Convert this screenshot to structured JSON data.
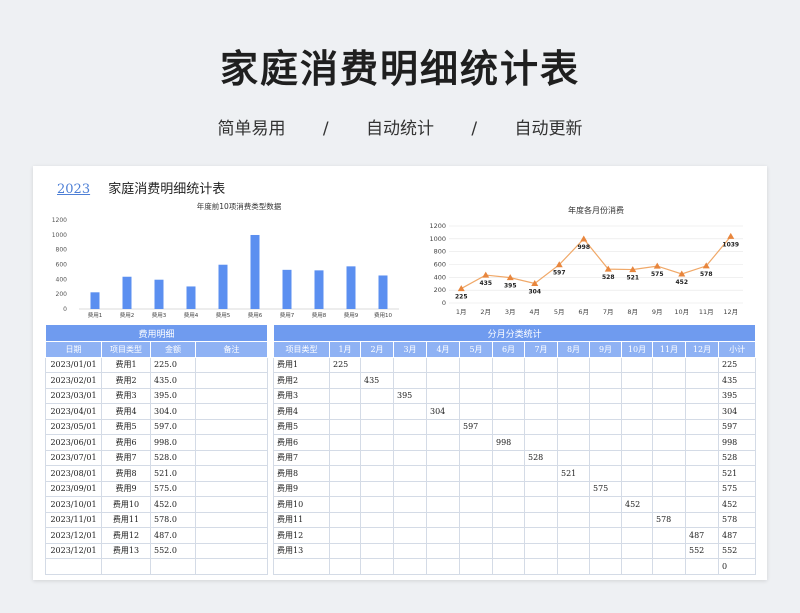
{
  "hero": {
    "title": "家庭消费明细统计表",
    "subtitle": [
      "简单易用",
      "/",
      "自动统计",
      "/",
      "自动更新"
    ]
  },
  "sheet": {
    "year": "2023",
    "title": "家庭消费明细统计表"
  },
  "colors": {
    "bar": "#5b8ff0",
    "line": "#f0a868",
    "marker": "#e8863d",
    "header": "#6f9bef",
    "subheader": "#8fb2f4"
  },
  "chart_data": [
    {
      "type": "bar",
      "title": "年度前10项消费类型数据",
      "categories": [
        "费用1",
        "费用2",
        "费用3",
        "费用4",
        "费用5",
        "费用6",
        "费用7",
        "费用8",
        "费用9",
        "费用10"
      ],
      "values": [
        225,
        435,
        395,
        304,
        597,
        998,
        528,
        521,
        575,
        452
      ],
      "ylim": [
        0,
        1200
      ],
      "yticks": [
        "0",
        "200",
        "400",
        "600",
        "800",
        "1000",
        "1200"
      ],
      "grid": false
    },
    {
      "type": "line",
      "title": "年度各月份消费",
      "categories": [
        "1月",
        "2月",
        "3月",
        "4月",
        "5月",
        "6月",
        "7月",
        "8月",
        "9月",
        "10月",
        "11月",
        "12月"
      ],
      "values": [
        225,
        435,
        395,
        304,
        597,
        998,
        528,
        521,
        575,
        452,
        578,
        1039
      ],
      "ylim": [
        0,
        1200
      ],
      "yticks": [
        "0",
        "200",
        "400",
        "600",
        "800",
        "1000",
        "1200"
      ],
      "grid": true
    }
  ],
  "detail_table": {
    "group_label": "费用明细",
    "headers": [
      "日期",
      "项目类型",
      "金额",
      "备注"
    ],
    "rows": [
      [
        "2023/01/01",
        "费用1",
        "225.0",
        ""
      ],
      [
        "2023/02/01",
        "费用2",
        "435.0",
        ""
      ],
      [
        "2023/03/01",
        "费用3",
        "395.0",
        ""
      ],
      [
        "2023/04/01",
        "费用4",
        "304.0",
        ""
      ],
      [
        "2023/05/01",
        "费用5",
        "597.0",
        ""
      ],
      [
        "2023/06/01",
        "费用6",
        "998.0",
        ""
      ],
      [
        "2023/07/01",
        "费用7",
        "528.0",
        ""
      ],
      [
        "2023/08/01",
        "费用8",
        "521.0",
        ""
      ],
      [
        "2023/09/01",
        "费用9",
        "575.0",
        ""
      ],
      [
        "2023/10/01",
        "费用10",
        "452.0",
        ""
      ],
      [
        "2023/11/01",
        "费用11",
        "578.0",
        ""
      ],
      [
        "2023/12/01",
        "费用12",
        "487.0",
        ""
      ],
      [
        "2023/12/01",
        "费用13",
        "552.0",
        ""
      ],
      [
        "",
        "",
        "",
        ""
      ]
    ]
  },
  "summary_table": {
    "group_label": "分月分类统计",
    "headers": [
      "项目类型",
      "1月",
      "2月",
      "3月",
      "4月",
      "5月",
      "6月",
      "7月",
      "8月",
      "9月",
      "10月",
      "11月",
      "12月",
      "小计"
    ],
    "rows": [
      [
        "费用1",
        "225",
        "",
        "",
        "",
        "",
        "",
        "",
        "",
        "",
        "",
        "",
        "",
        "225"
      ],
      [
        "费用2",
        "",
        "435",
        "",
        "",
        "",
        "",
        "",
        "",
        "",
        "",
        "",
        "",
        "435"
      ],
      [
        "费用3",
        "",
        "",
        "395",
        "",
        "",
        "",
        "",
        "",
        "",
        "",
        "",
        "",
        "395"
      ],
      [
        "费用4",
        "",
        "",
        "",
        "304",
        "",
        "",
        "",
        "",
        "",
        "",
        "",
        "",
        "304"
      ],
      [
        "费用5",
        "",
        "",
        "",
        "",
        "597",
        "",
        "",
        "",
        "",
        "",
        "",
        "",
        "597"
      ],
      [
        "费用6",
        "",
        "",
        "",
        "",
        "",
        "998",
        "",
        "",
        "",
        "",
        "",
        "",
        "998"
      ],
      [
        "费用7",
        "",
        "",
        "",
        "",
        "",
        "",
        "528",
        "",
        "",
        "",
        "",
        "",
        "528"
      ],
      [
        "费用8",
        "",
        "",
        "",
        "",
        "",
        "",
        "",
        "521",
        "",
        "",
        "",
        "",
        "521"
      ],
      [
        "费用9",
        "",
        "",
        "",
        "",
        "",
        "",
        "",
        "",
        "575",
        "",
        "",
        "",
        "575"
      ],
      [
        "费用10",
        "",
        "",
        "",
        "",
        "",
        "",
        "",
        "",
        "",
        "452",
        "",
        "",
        "452"
      ],
      [
        "费用11",
        "",
        "",
        "",
        "",
        "",
        "",
        "",
        "",
        "",
        "",
        "578",
        "",
        "578"
      ],
      [
        "费用12",
        "",
        "",
        "",
        "",
        "",
        "",
        "",
        "",
        "",
        "",
        "",
        "487",
        "487"
      ],
      [
        "费用13",
        "",
        "",
        "",
        "",
        "",
        "",
        "",
        "",
        "",
        "",
        "",
        "552",
        "552"
      ],
      [
        "",
        "",
        "",
        "",
        "",
        "",
        "",
        "",
        "",
        "",
        "",
        "",
        "",
        "0"
      ]
    ]
  }
}
